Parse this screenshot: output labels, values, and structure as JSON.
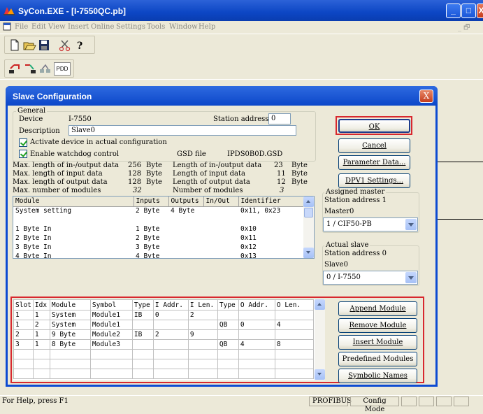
{
  "window": {
    "title": "SyCon.EXE - [I-7550QC.pb]",
    "minimize_glyph": "_",
    "maximize_glyph": "□",
    "close_glyph": "X"
  },
  "menu": {
    "items": [
      "File",
      "Edit",
      "View",
      "Insert",
      "Online",
      "Settings",
      "Tools",
      "Window",
      "Help"
    ],
    "mdi_controls": "_ 🗗"
  },
  "toolbar": {
    "buttons": [
      "new-icon",
      "open-icon",
      "save-icon",
      "cut-icon",
      "help-icon"
    ],
    "second_row": [
      "upload-icon",
      "download-icon",
      "network-icon",
      "pdd-button"
    ],
    "pdd_label": "PDD"
  },
  "dialog": {
    "title": "Slave Configuration",
    "close_glyph": "X",
    "general": {
      "group_label": "General",
      "device_label": "Device",
      "device_value": "I-7550",
      "station_address_label": "Station address",
      "station_address_value": "0",
      "description_label": "Description",
      "description_value": "Slave0",
      "activate_label": "Activate device in actual configuration",
      "watchdog_label": "Enable watchdog control",
      "gsd_file_label": "GSD file",
      "gsd_file_value": "IPDS0B0D.GSD"
    },
    "stats_left": [
      {
        "label": "Max. length of in-/output data",
        "value": "256",
        "unit": "Byte"
      },
      {
        "label": "Max. length of input data",
        "value": "128",
        "unit": "Byte"
      },
      {
        "label": "Max. length of output data",
        "value": "128",
        "unit": "Byte"
      },
      {
        "label": "Max. number of modules",
        "value": "32",
        "unit": ""
      }
    ],
    "stats_right": [
      {
        "label": "Length of in-/output data",
        "value": "23",
        "unit": "Byte"
      },
      {
        "label": "Length of input data",
        "value": "11",
        "unit": "Byte"
      },
      {
        "label": "Length of output data",
        "value": "12",
        "unit": "Byte"
      },
      {
        "label": "Number of modules",
        "value": "3",
        "unit": ""
      }
    ],
    "module_list": {
      "columns": [
        "Module",
        "Inputs",
        "Outputs",
        "In/Out",
        "Identifier"
      ],
      "rows": [
        [
          "System setting",
          "2 Byte",
          "4 Byte",
          "",
          "0x11, 0x23"
        ],
        [
          "",
          "",
          "",
          "",
          ""
        ],
        [
          "1 Byte In",
          "1 Byte",
          "",
          "",
          "0x10"
        ],
        [
          "2 Byte In",
          "2 Byte",
          "",
          "",
          "0x11"
        ],
        [
          "3 Byte In",
          "3 Byte",
          "",
          "",
          "0x12"
        ],
        [
          "4 Byte In",
          "4 Byte",
          "",
          "",
          "0x13"
        ]
      ]
    },
    "buttons": {
      "ok": "OK",
      "cancel": "Cancel",
      "parameter_data": "Parameter Data...",
      "dpv1_settings": "DPV1 Settings..."
    },
    "assigned_master": {
      "group_label": "Assigned master",
      "station_address": "Station address 1",
      "name": "Master0",
      "selected": "1 / CIF50-PB"
    },
    "actual_slave": {
      "group_label": "Actual slave",
      "station_address": "Station address 0",
      "name": "Slave0",
      "selected": "0 / I-7550"
    },
    "slot_table": {
      "columns": [
        "Slot",
        "Idx",
        "Module",
        "Symbol",
        "Type",
        "I Addr.",
        "I Len.",
        "Type",
        "O Addr.",
        "O Len."
      ],
      "rows": [
        [
          "1",
          "1",
          "System",
          "Module1",
          "IB",
          "0",
          "2",
          "",
          "",
          ""
        ],
        [
          "1",
          "2",
          "System",
          "Module1",
          "",
          "",
          "",
          "QB",
          "0",
          "4"
        ],
        [
          "2",
          "1",
          "9 Byte",
          "Module2",
          "IB",
          "2",
          "9",
          "",
          "",
          ""
        ],
        [
          "3",
          "1",
          "8 Byte",
          "Module3",
          "",
          "",
          "",
          "QB",
          "4",
          "8"
        ],
        [
          "",
          "",
          "",
          "",
          "",
          "",
          "",
          "",
          "",
          ""
        ],
        [
          "",
          "",
          "",
          "",
          "",
          "",
          "",
          "",
          "",
          ""
        ],
        [
          "",
          "",
          "",
          "",
          "",
          "",
          "",
          "",
          "",
          ""
        ]
      ]
    },
    "module_buttons": {
      "append": "Append Module",
      "remove": "Remove Module",
      "insert": "Insert Module",
      "predefined": "Predefined Modules",
      "symbolic": "Symbolic Names"
    }
  },
  "status_bar": {
    "help_text": "For Help, press F1",
    "protocol": "PROFIBUS",
    "mode": "Config Mode"
  },
  "colors": {
    "highlight_border": "#d8282e",
    "title_blue": "#0c47c9"
  }
}
